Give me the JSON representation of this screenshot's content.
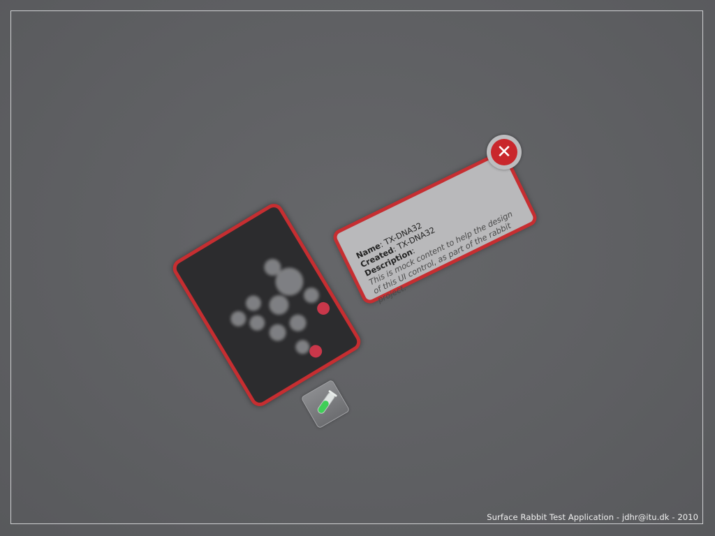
{
  "app": {
    "footer": "Surface Rabbit Test Application - jdhr@itu.dk - 2010"
  },
  "info_panel": {
    "name_label": "Name",
    "name_value": ": TX-DNA32",
    "created_label": "Created",
    "created_value": ": TX-DNA32",
    "description_label": "Description",
    "description_colon": ":",
    "description_text": "This is mock content to help the design of this UI control, as part of the rabbit project.",
    "close_glyph": "✕"
  },
  "colors": {
    "accent_red": "#c62e31",
    "card_dark": "#2c2c2e",
    "panel_light": "#b9b9bb",
    "tube_green": "#3fcf57"
  },
  "icons": {
    "close": "close-icon",
    "test_tube": "test-tube-icon",
    "molecule": "molecule-graphic"
  }
}
